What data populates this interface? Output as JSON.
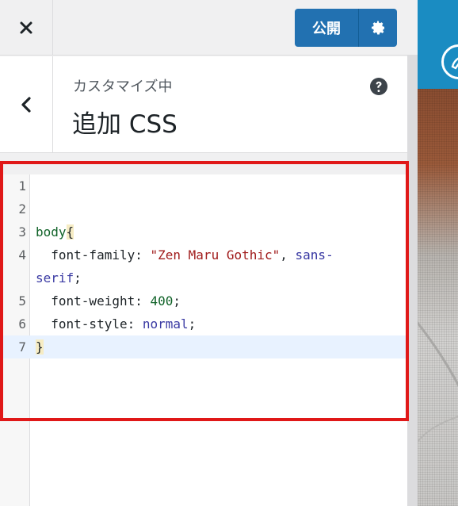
{
  "header": {
    "publish_label": "公開",
    "close_icon": "close-icon",
    "gear_icon": "gear-icon"
  },
  "section": {
    "subtitle": "カスタマイズ中",
    "title": "追加 CSS",
    "help_icon": "question-circle-icon",
    "back_icon": "chevron-left-icon"
  },
  "editor": {
    "lines": [
      {
        "number": "1",
        "text": ""
      },
      {
        "number": "2",
        "text": ""
      },
      {
        "number": "3",
        "text": "body{"
      },
      {
        "number": "4",
        "text": "  font-family: \"Zen Maru Gothic\", sans-",
        "continuation": "serif;"
      },
      {
        "number": "5",
        "text": "  font-weight: 400;"
      },
      {
        "number": "6",
        "text": "  font-style: normal;"
      },
      {
        "number": "7",
        "text": "}"
      }
    ],
    "tokens": {
      "selector": "body",
      "open_brace": "{",
      "prop1": "font-family",
      "val1_str": "\"Zen Maru Gothic\"",
      "val1_sep": ", ",
      "val1_kw_a": "sans-",
      "val1_kw_b": "serif",
      "prop2": "font-weight",
      "val2": "400",
      "prop3": "font-style",
      "val3": "normal",
      "close_brace": "}"
    },
    "active_line": "7"
  },
  "colors": {
    "accent": "#2271b1",
    "highlight_border": "#e01818",
    "preview_header": "#1a8cc2"
  }
}
